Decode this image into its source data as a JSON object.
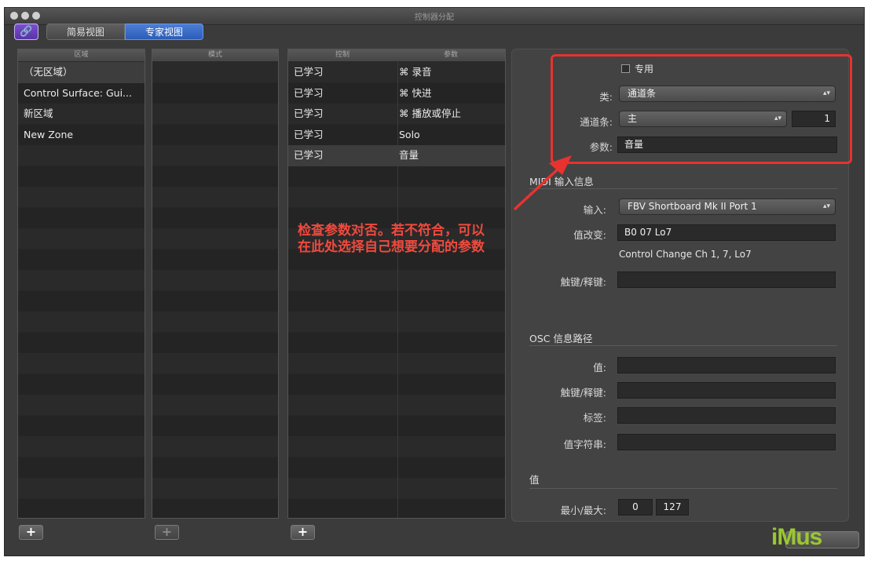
{
  "window": {
    "title": "控制器分配"
  },
  "view_tabs": {
    "simple": "简易视图",
    "expert": "专家视图"
  },
  "link_button": {
    "glyph": "🔗"
  },
  "zone_pane": {
    "header": "区域",
    "rows": [
      "（无区域）",
      "Control Surface: Gui...",
      "新区域",
      "New Zone"
    ]
  },
  "mode_pane": {
    "header": "模式"
  },
  "control_pane": {
    "header_control": "控制",
    "header_param": "参数",
    "rows": [
      {
        "control": "已学习",
        "param": "⌘ 录音"
      },
      {
        "control": "已学习",
        "param": "⌘ 快进"
      },
      {
        "control": "已学习",
        "param": "⌘ 播放或停止"
      },
      {
        "control": "已学习",
        "param": "Solo"
      },
      {
        "control": "已学习",
        "param": "音量"
      }
    ]
  },
  "inspector": {
    "exclusive_label": "专用",
    "class_label": "类:",
    "class_value": "通道条",
    "strip_label": "通道条:",
    "strip_value": "主",
    "strip_number": "1",
    "param_label": "参数:",
    "param_value": "音量",
    "midi_section": "MIDI 输入信息",
    "input_label": "输入:",
    "input_value": "FBV Shortboard Mk II Port 1",
    "value_change_label": "值改变:",
    "value_change_value": "B0 07 Lo7",
    "value_change_desc": "Control Change Ch 1, 7, Lo7",
    "touch_release_label": "触键/释键:",
    "osc_section": "OSC 信息路径",
    "osc_value_label": "值:",
    "osc_touch_label": "触键/释键:",
    "osc_tag_label": "标签:",
    "osc_string_label": "值字符串:",
    "value_section": "值",
    "minmax_label": "最小/最大:",
    "min_value": "0",
    "max_value": "127"
  },
  "annotation": {
    "line1": "检查参数对否。若不符合，可以",
    "line2": "在此处选择自己想要分配的参数"
  },
  "logo": {
    "text": "iMus"
  },
  "plus_glyph": "+",
  "colors": {
    "annotation_red": "#e8322f",
    "expert_tab": "#3a6cc8",
    "link_purple": "#6a40bf"
  }
}
